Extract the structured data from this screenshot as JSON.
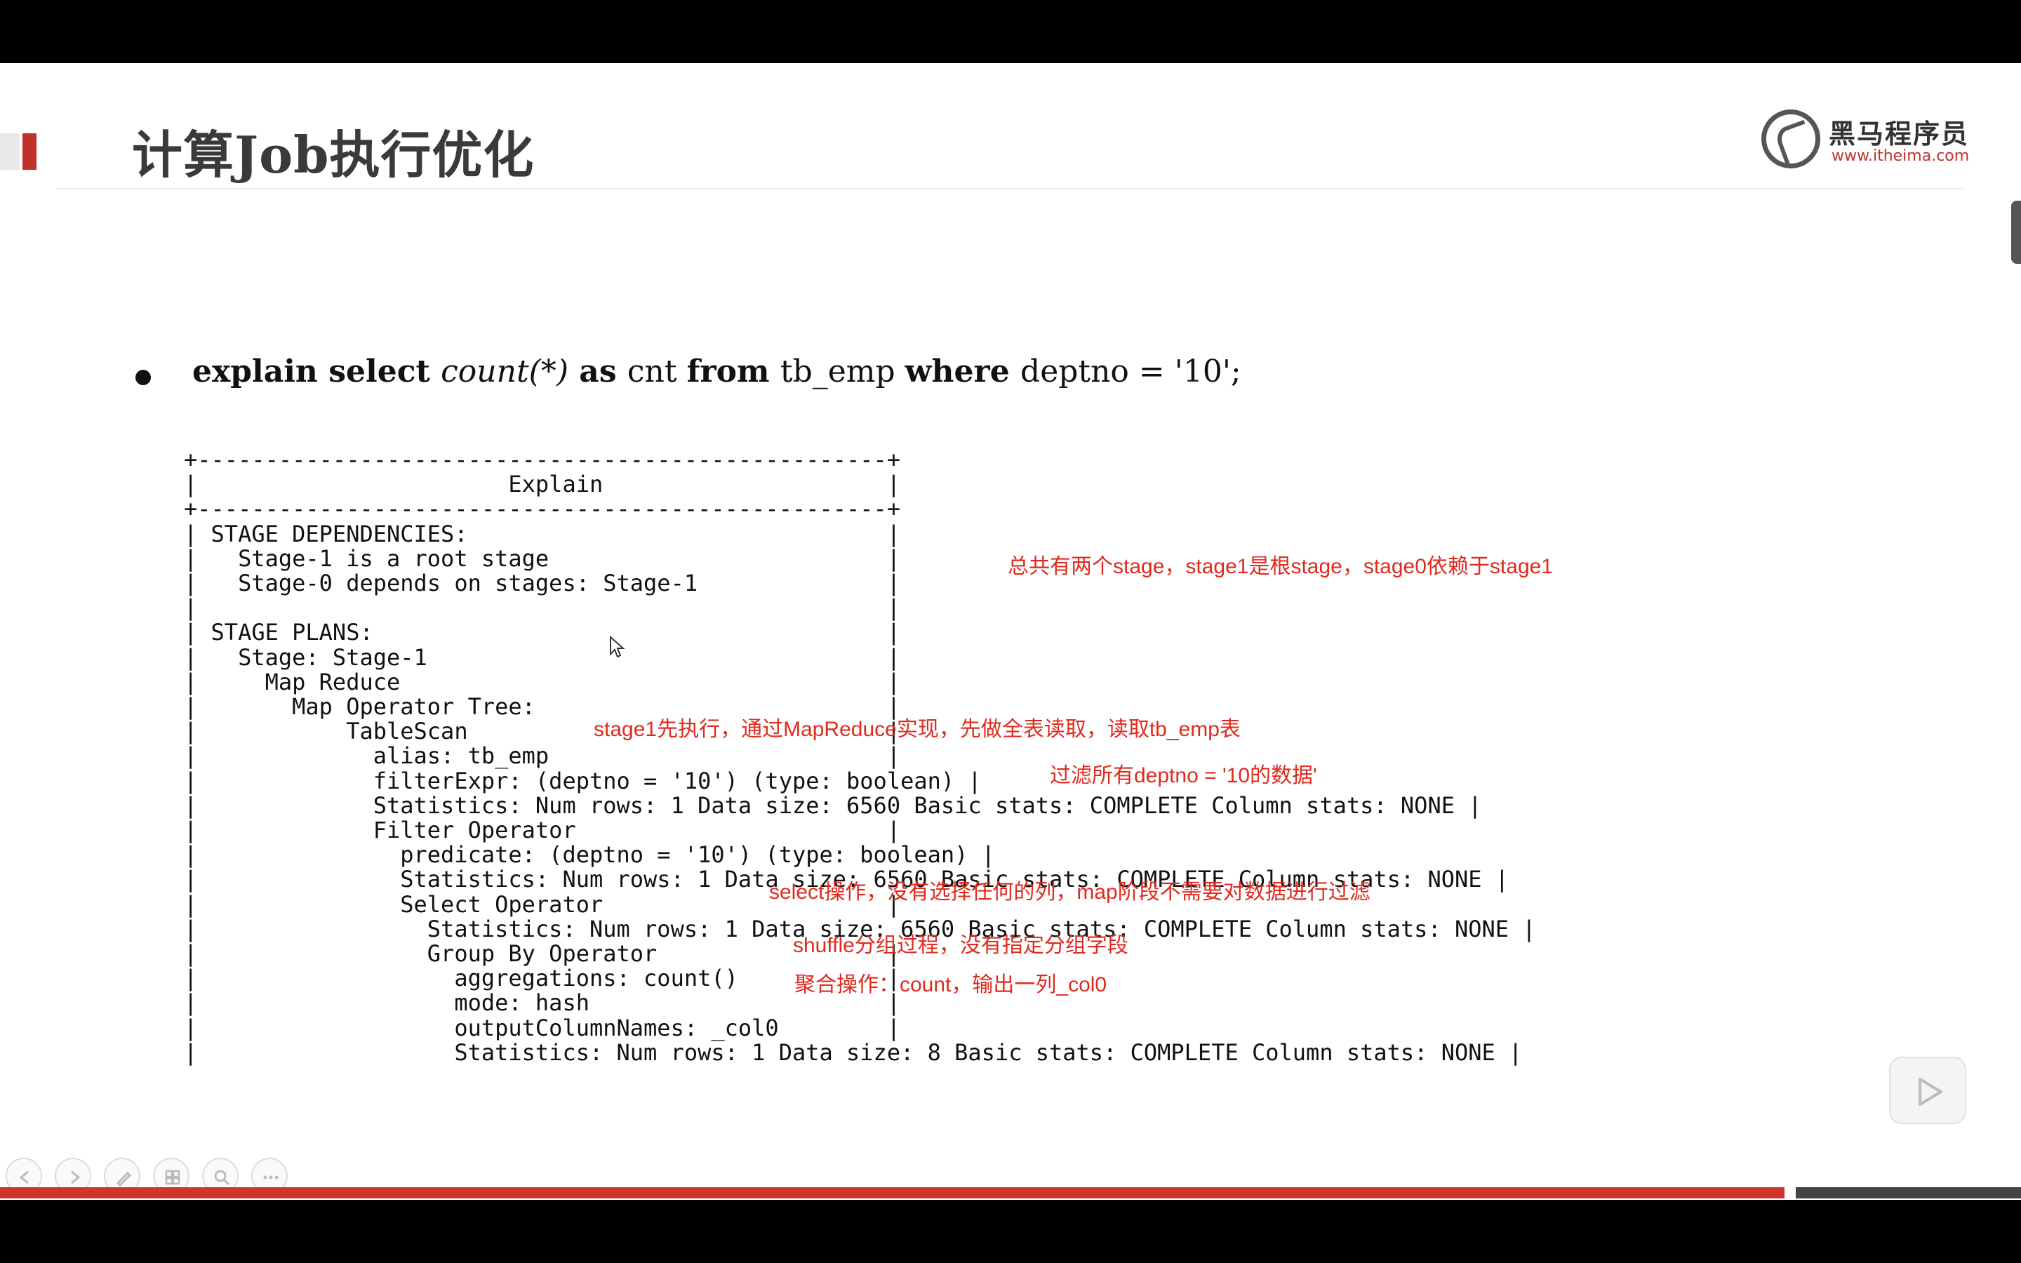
{
  "slide": {
    "title": "计算Job执行优化",
    "logo": {
      "name": "黑马程序员",
      "url": "www.itheima.com"
    }
  },
  "bullet": {
    "kw_explain": "explain select ",
    "fn_count": "count(*)",
    "kw_as": " as ",
    "plain_cnt": "cnt ",
    "kw_from": "from ",
    "plain_table": "tb_emp ",
    "kw_where": "where ",
    "plain_cond": "deptno = '10';"
  },
  "explain_output": [
    "+---------------------------------------------------+",
    "|                       Explain                     |",
    "+---------------------------------------------------+",
    "| STAGE DEPENDENCIES:                               |",
    "|   Stage-1 is a root stage                         |",
    "|   Stage-0 depends on stages: Stage-1              |",
    "|                                                   |",
    "| STAGE PLANS:                                      |",
    "|   Stage: Stage-1                                  |",
    "|     Map Reduce                                    |",
    "|       Map Operator Tree:                          |",
    "|           TableScan                               |",
    "|             alias: tb_emp                         |",
    "|             filterExpr: (deptno = '10') (type: boolean) |",
    "|             Statistics: Num rows: 1 Data size: 6560 Basic stats: COMPLETE Column stats: NONE |",
    "|             Filter Operator                       |",
    "|               predicate: (deptno = '10') (type: boolean) |",
    "|               Statistics: Num rows: 1 Data size: 6560 Basic stats: COMPLETE Column stats: NONE |",
    "|               Select Operator                     |",
    "|                 Statistics: Num rows: 1 Data size: 6560 Basic stats: COMPLETE Column stats: NONE |",
    "|                 Group By Operator                 |",
    "|                   aggregations: count()           |",
    "|                   mode: hash                      |",
    "|                   outputColumnNames: _col0        |",
    "|                   Statistics: Num rows: 1 Data size: 8 Basic stats: COMPLETE Column stats: NONE |"
  ],
  "annotations": {
    "stages": "总共有两个stage，stage1是根stage，stage0依赖于stage1",
    "stage1": "stage1先执行，通过MapReduce实现，先做全表读取，读取tb_emp表",
    "filter": "过滤所有deptno = '10的数据'",
    "select": "select操作，没有选择任何的列，map阶段不需要对数据进行过滤",
    "shuffle": "shuffle分组过程，没有指定分组字段",
    "aggregate": "聚合操作：count，输出一列_col0"
  },
  "player": {
    "toolbar_icons": [
      "prev-icon",
      "next-icon",
      "pen-icon",
      "slides-icon",
      "zoom-icon",
      "more-icon"
    ],
    "progress": 0.883,
    "accent_color": "#d0342c"
  }
}
